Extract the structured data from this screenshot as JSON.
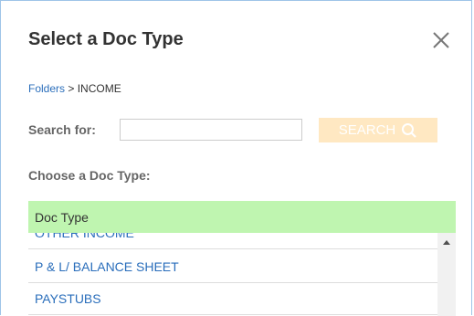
{
  "dialog": {
    "title": "Select a Doc Type"
  },
  "breadcrumb": {
    "folders_link": "Folders",
    "separator": " > ",
    "current": "INCOME"
  },
  "search": {
    "label": "Search for:",
    "value": "",
    "placeholder": "",
    "button_label": "SEARCH",
    "button_icon": "search-icon"
  },
  "doc_type": {
    "choose_label": "Choose a Doc Type:",
    "header": "Doc Type",
    "items": [
      {
        "label": "OTHER INCOME"
      },
      {
        "label": "P & L/ BALANCE SHEET"
      },
      {
        "label": "PAYSTUBS"
      }
    ]
  },
  "colors": {
    "header_bg": "#bff5b0",
    "search_button_bg": "#ffe8c2",
    "link": "#2a6ebb",
    "border": "#9ec4e8"
  }
}
